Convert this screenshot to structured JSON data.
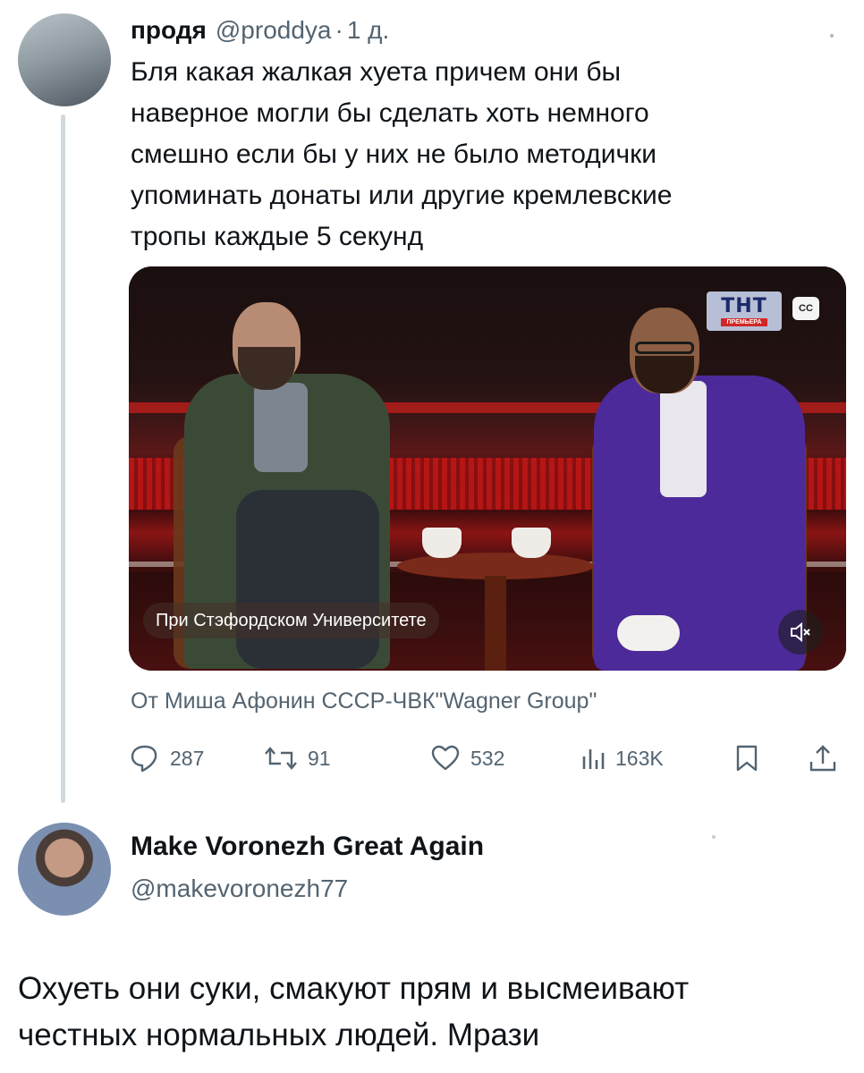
{
  "tweet1": {
    "author_name": "продя",
    "author_handle": "@proddya",
    "separator": "·",
    "time": "1 д.",
    "text_lines": [
      "Бля какая жалкая хуета причем они бы",
      "наверное могли бы сделать хоть немного",
      "смешно если бы у них не было методички",
      "упоминать донаты или другие кремлевские",
      "тропы каждые 5 секунд"
    ],
    "video": {
      "channel_logo": "ТНТ",
      "channel_sublabel": "ПРЕМЬЕРА",
      "cc_label": "CC",
      "caption": "При Стэфордском Университете",
      "mute_icon": "speaker-muted-icon"
    },
    "source": "От Миша Афонин СССР-ЧВК\"Wagner Group\"",
    "stats": {
      "replies": "287",
      "retweets": "91",
      "likes": "532",
      "views": "163K"
    }
  },
  "tweet2": {
    "author_name": "Make Voronezh Great Again",
    "author_handle": "@makevoronezh77",
    "text_lines": [
      "Охуеть они суки, смакуют прям и высмеивают",
      "честных нормальных людей. Мрази"
    ]
  },
  "colors": {
    "text": "#0f1419",
    "secondary": "#536471",
    "thread_line": "#cfd9de"
  }
}
